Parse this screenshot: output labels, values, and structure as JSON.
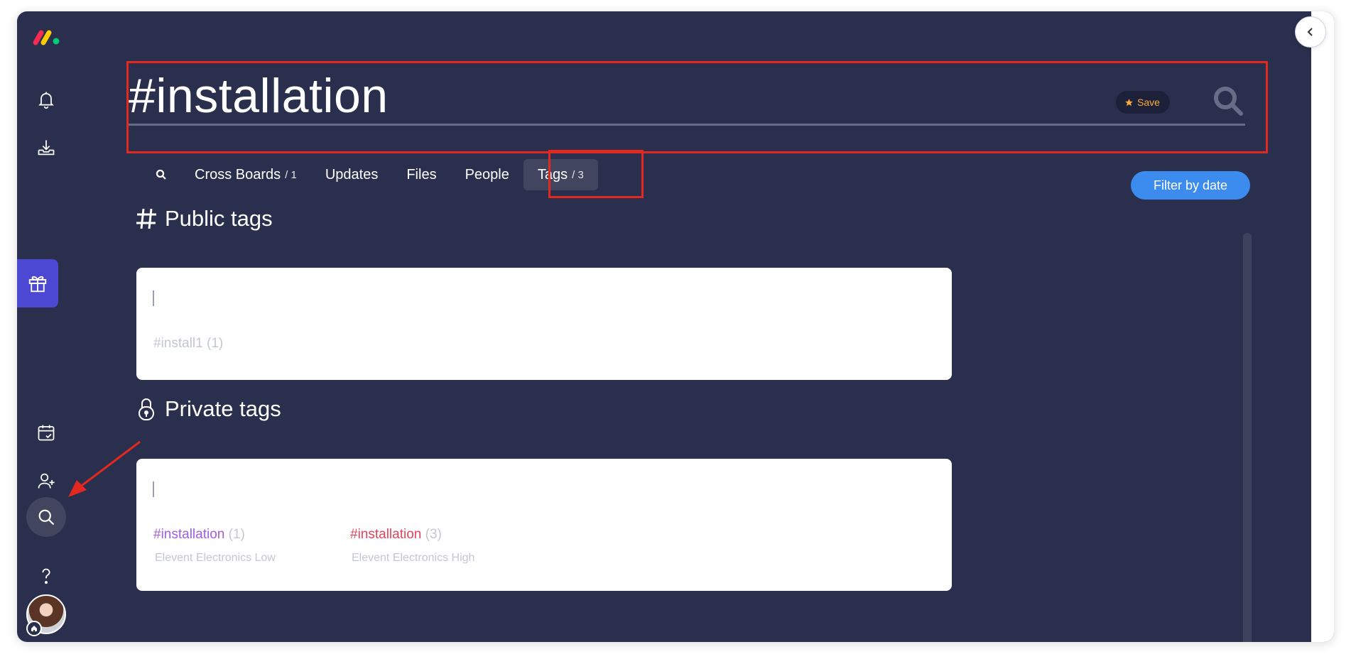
{
  "search": {
    "query": "#installation",
    "save_label": "Save"
  },
  "tabs": [
    {
      "label": "Cross Boards",
      "count": "/ 1"
    },
    {
      "label": "Updates",
      "count": ""
    },
    {
      "label": "Files",
      "count": ""
    },
    {
      "label": "People",
      "count": ""
    },
    {
      "label": "Tags",
      "count": "/ 3"
    }
  ],
  "filter_label": "Filter by date",
  "public_section": {
    "title": "Public tags",
    "tags": [
      {
        "name": "#install1",
        "count": "(1)"
      }
    ]
  },
  "private_section": {
    "title": "Private tags",
    "tags": [
      {
        "name": "#installation",
        "count": "(1)",
        "board": "Elevent Electronics Low",
        "color": "#a25ddc"
      },
      {
        "name": "#installation",
        "count": "(3)",
        "board": "Elevent Electronics High",
        "color": "#e2445c"
      }
    ]
  },
  "colors": {
    "background": "#292f4c",
    "accent": "#3c8cf0",
    "save": "#fdab3d",
    "annotation": "#e2281f"
  },
  "sidebar_icons": [
    "monday-logo",
    "bell-icon",
    "inbox-download-icon",
    "gift-icon",
    "calendar-check-icon",
    "invite-user-icon",
    "search-icon",
    "help-icon",
    "avatar"
  ]
}
